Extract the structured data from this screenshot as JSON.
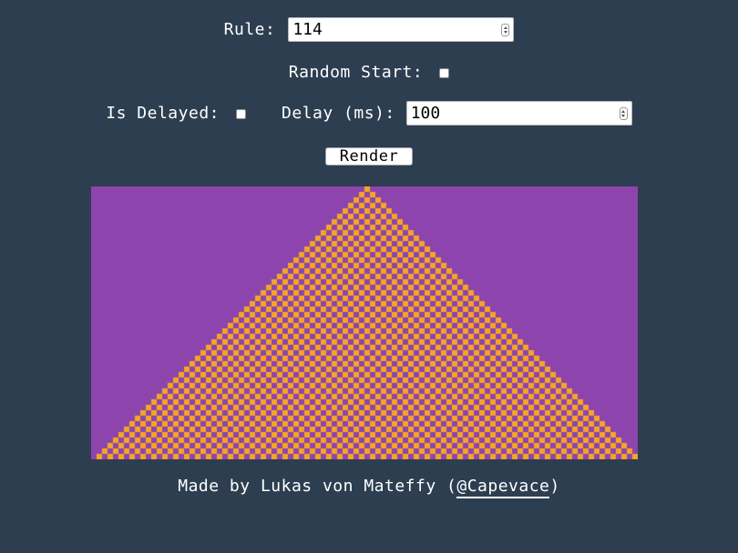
{
  "controls": {
    "rule_label": "Rule:",
    "rule_value": "114",
    "random_start_label": "Random Start:",
    "random_start_checked": false,
    "is_delayed_label": "Is Delayed:",
    "is_delayed_checked": false,
    "delay_label": "Delay (ms):",
    "delay_value": "100",
    "render_label": "Render"
  },
  "automaton": {
    "cell_count": 100,
    "generations": 50,
    "live_color": "#f5a623",
    "dead_color": "#8e44ad"
  },
  "colors": {
    "background": "#2d3e50",
    "text": "#ffffff"
  },
  "footer": {
    "prefix": "Made by Lukas von Mateffy (",
    "link_text": "@Capevace",
    "suffix": ")"
  }
}
